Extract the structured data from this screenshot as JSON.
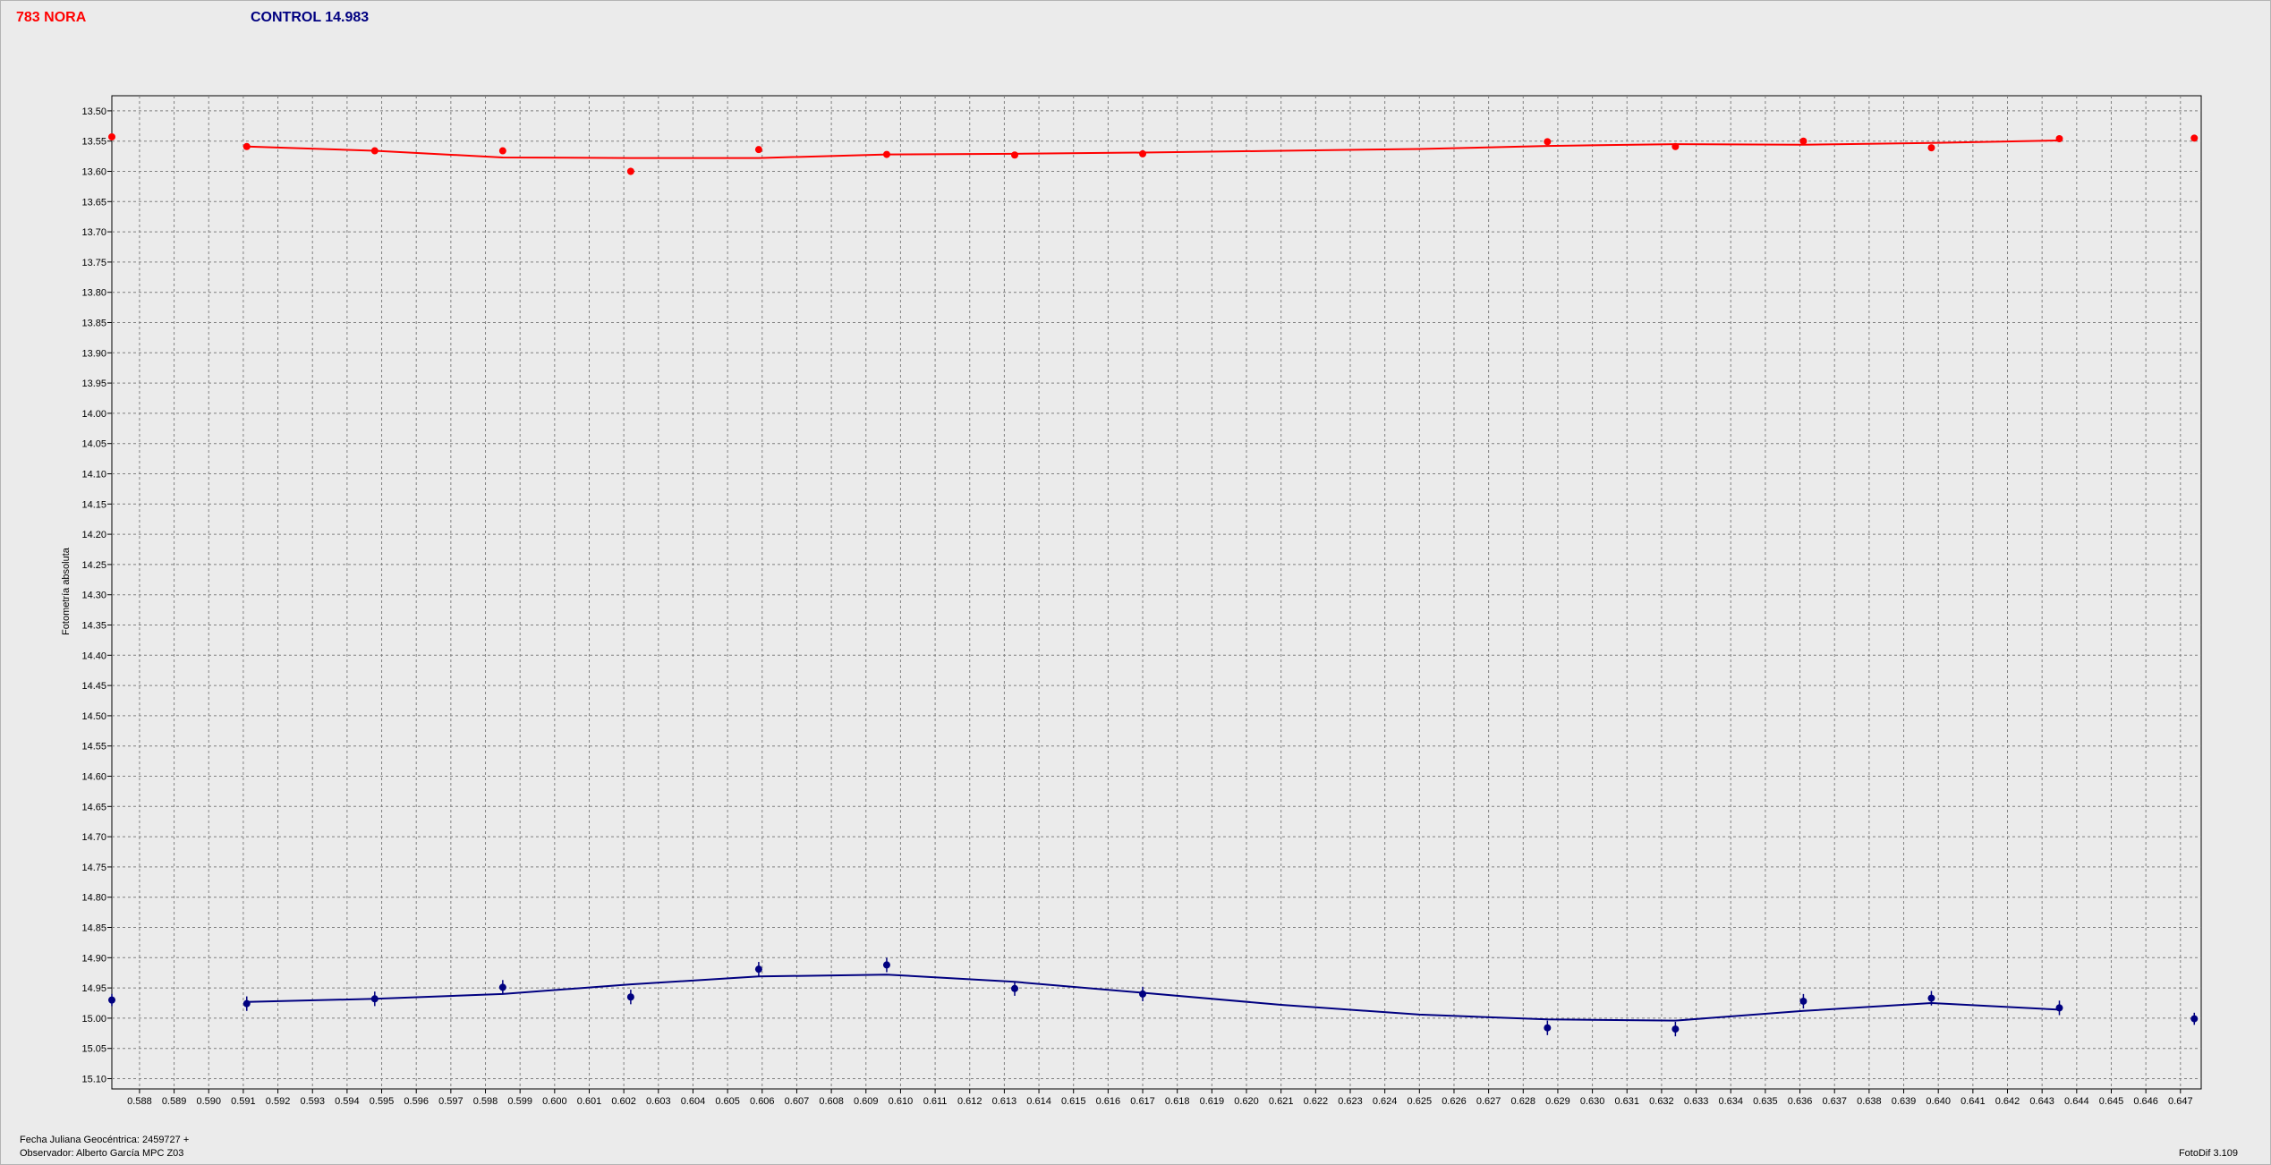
{
  "header": {
    "object_label": "783 NORA",
    "control_label": "CONTROL 14.983"
  },
  "footer": {
    "julian_label": "Fecha Juliana Geocéntrica: 2459727 +",
    "observer_label": "Observador: Alberto García MPC Z03",
    "software_label": "FotoDif 3.109"
  },
  "colors": {
    "object_series": "#ff0000",
    "control_series": "#000080",
    "plot_background": "#ebebeb",
    "grid": "#808080"
  },
  "chart_data": {
    "type": "scatter",
    "title": "",
    "xlabel": "",
    "ylabel": "Fotometría absoluta",
    "xlim": [
      0.5872,
      0.6476
    ],
    "ylim": [
      13.475,
      15.117
    ],
    "y_inverted": true,
    "grid": true,
    "x_ticks": [
      "0.588",
      "0.589",
      "0.590",
      "0.591",
      "0.592",
      "0.593",
      "0.594",
      "0.595",
      "0.596",
      "0.597",
      "0.598",
      "0.599",
      "0.600",
      "0.601",
      "0.602",
      "0.603",
      "0.604",
      "0.605",
      "0.606",
      "0.607",
      "0.608",
      "0.609",
      "0.610",
      "0.611",
      "0.612",
      "0.613",
      "0.614",
      "0.615",
      "0.616",
      "0.617",
      "0.618",
      "0.619",
      "0.620",
      "0.621",
      "0.622",
      "0.623",
      "0.624",
      "0.625",
      "0.626",
      "0.627",
      "0.628",
      "0.629",
      "0.630",
      "0.631",
      "0.632",
      "0.633",
      "0.634",
      "0.635",
      "0.636",
      "0.637",
      "0.638",
      "0.639",
      "0.640",
      "0.641",
      "0.642",
      "0.643",
      "0.644",
      "0.645",
      "0.646",
      "0.647"
    ],
    "y_ticks": [
      "13.50",
      "13.55",
      "13.60",
      "13.65",
      "13.70",
      "13.75",
      "13.80",
      "13.85",
      "13.90",
      "13.95",
      "14.00",
      "14.05",
      "14.10",
      "14.15",
      "14.20",
      "14.25",
      "14.30",
      "14.35",
      "14.40",
      "14.45",
      "14.50",
      "14.55",
      "14.60",
      "14.65",
      "14.70",
      "14.75",
      "14.80",
      "14.85",
      "14.90",
      "14.95",
      "15.00",
      "15.05",
      "15.10"
    ],
    "series": [
      {
        "name": "783 NORA",
        "color": "#ff0000",
        "points": [
          {
            "x": 0.5872,
            "y": 13.543,
            "err": 0.004
          },
          {
            "x": 0.5911,
            "y": 13.559,
            "err": 0.005
          },
          {
            "x": 0.5948,
            "y": 13.566,
            "err": 0.005
          },
          {
            "x": 0.5985,
            "y": 13.566,
            "err": 0.005
          },
          {
            "x": 0.6022,
            "y": 13.6,
            "err": 0.006
          },
          {
            "x": 0.6059,
            "y": 13.564,
            "err": 0.005
          },
          {
            "x": 0.6096,
            "y": 13.572,
            "err": 0.005
          },
          {
            "x": 0.6133,
            "y": 13.573,
            "err": 0.005
          },
          {
            "x": 0.617,
            "y": 13.571,
            "err": 0.005
          },
          {
            "x": 0.6287,
            "y": 13.551,
            "err": 0.005
          },
          {
            "x": 0.6324,
            "y": 13.559,
            "err": 0.005
          },
          {
            "x": 0.6361,
            "y": 13.55,
            "err": 0.005
          },
          {
            "x": 0.6398,
            "y": 13.561,
            "err": 0.005
          },
          {
            "x": 0.6435,
            "y": 13.546,
            "err": 0.005
          },
          {
            "x": 0.6474,
            "y": 13.545,
            "err": 0.004
          }
        ],
        "fit": [
          {
            "x": 0.5911,
            "y": 13.559
          },
          {
            "x": 0.5948,
            "y": 13.566
          },
          {
            "x": 0.5985,
            "y": 13.577
          },
          {
            "x": 0.6022,
            "y": 13.578
          },
          {
            "x": 0.6059,
            "y": 13.578
          },
          {
            "x": 0.6096,
            "y": 13.572
          },
          {
            "x": 0.6133,
            "y": 13.571
          },
          {
            "x": 0.617,
            "y": 13.569
          },
          {
            "x": 0.621,
            "y": 13.566
          },
          {
            "x": 0.625,
            "y": 13.563
          },
          {
            "x": 0.6287,
            "y": 13.558
          },
          {
            "x": 0.6324,
            "y": 13.555
          },
          {
            "x": 0.6361,
            "y": 13.556
          },
          {
            "x": 0.6398,
            "y": 13.553
          },
          {
            "x": 0.6435,
            "y": 13.549
          }
        ]
      },
      {
        "name": "CONTROL 14.983",
        "color": "#000080",
        "points": [
          {
            "x": 0.5872,
            "y": 14.97,
            "err": 0.01
          },
          {
            "x": 0.5911,
            "y": 14.976,
            "err": 0.012
          },
          {
            "x": 0.5948,
            "y": 14.968,
            "err": 0.012
          },
          {
            "x": 0.5985,
            "y": 14.949,
            "err": 0.012
          },
          {
            "x": 0.6022,
            "y": 14.965,
            "err": 0.012
          },
          {
            "x": 0.6059,
            "y": 14.919,
            "err": 0.012
          },
          {
            "x": 0.6096,
            "y": 14.912,
            "err": 0.012
          },
          {
            "x": 0.6133,
            "y": 14.951,
            "err": 0.012
          },
          {
            "x": 0.617,
            "y": 14.96,
            "err": 0.012
          },
          {
            "x": 0.6287,
            "y": 15.016,
            "err": 0.012
          },
          {
            "x": 0.6324,
            "y": 15.018,
            "err": 0.012
          },
          {
            "x": 0.6361,
            "y": 14.972,
            "err": 0.012
          },
          {
            "x": 0.6398,
            "y": 14.967,
            "err": 0.012
          },
          {
            "x": 0.6435,
            "y": 14.983,
            "err": 0.012
          },
          {
            "x": 0.6474,
            "y": 15.001,
            "err": 0.01
          }
        ],
        "fit": [
          {
            "x": 0.5911,
            "y": 14.973
          },
          {
            "x": 0.5948,
            "y": 14.968
          },
          {
            "x": 0.5985,
            "y": 14.96
          },
          {
            "x": 0.6022,
            "y": 14.944
          },
          {
            "x": 0.6059,
            "y": 14.931
          },
          {
            "x": 0.6096,
            "y": 14.928
          },
          {
            "x": 0.6133,
            "y": 14.94
          },
          {
            "x": 0.617,
            "y": 14.958
          },
          {
            "x": 0.621,
            "y": 14.978
          },
          {
            "x": 0.625,
            "y": 14.994
          },
          {
            "x": 0.6287,
            "y": 15.002
          },
          {
            "x": 0.6324,
            "y": 15.004
          },
          {
            "x": 0.6361,
            "y": 14.988
          },
          {
            "x": 0.6398,
            "y": 14.975
          },
          {
            "x": 0.6435,
            "y": 14.986
          }
        ]
      }
    ]
  }
}
